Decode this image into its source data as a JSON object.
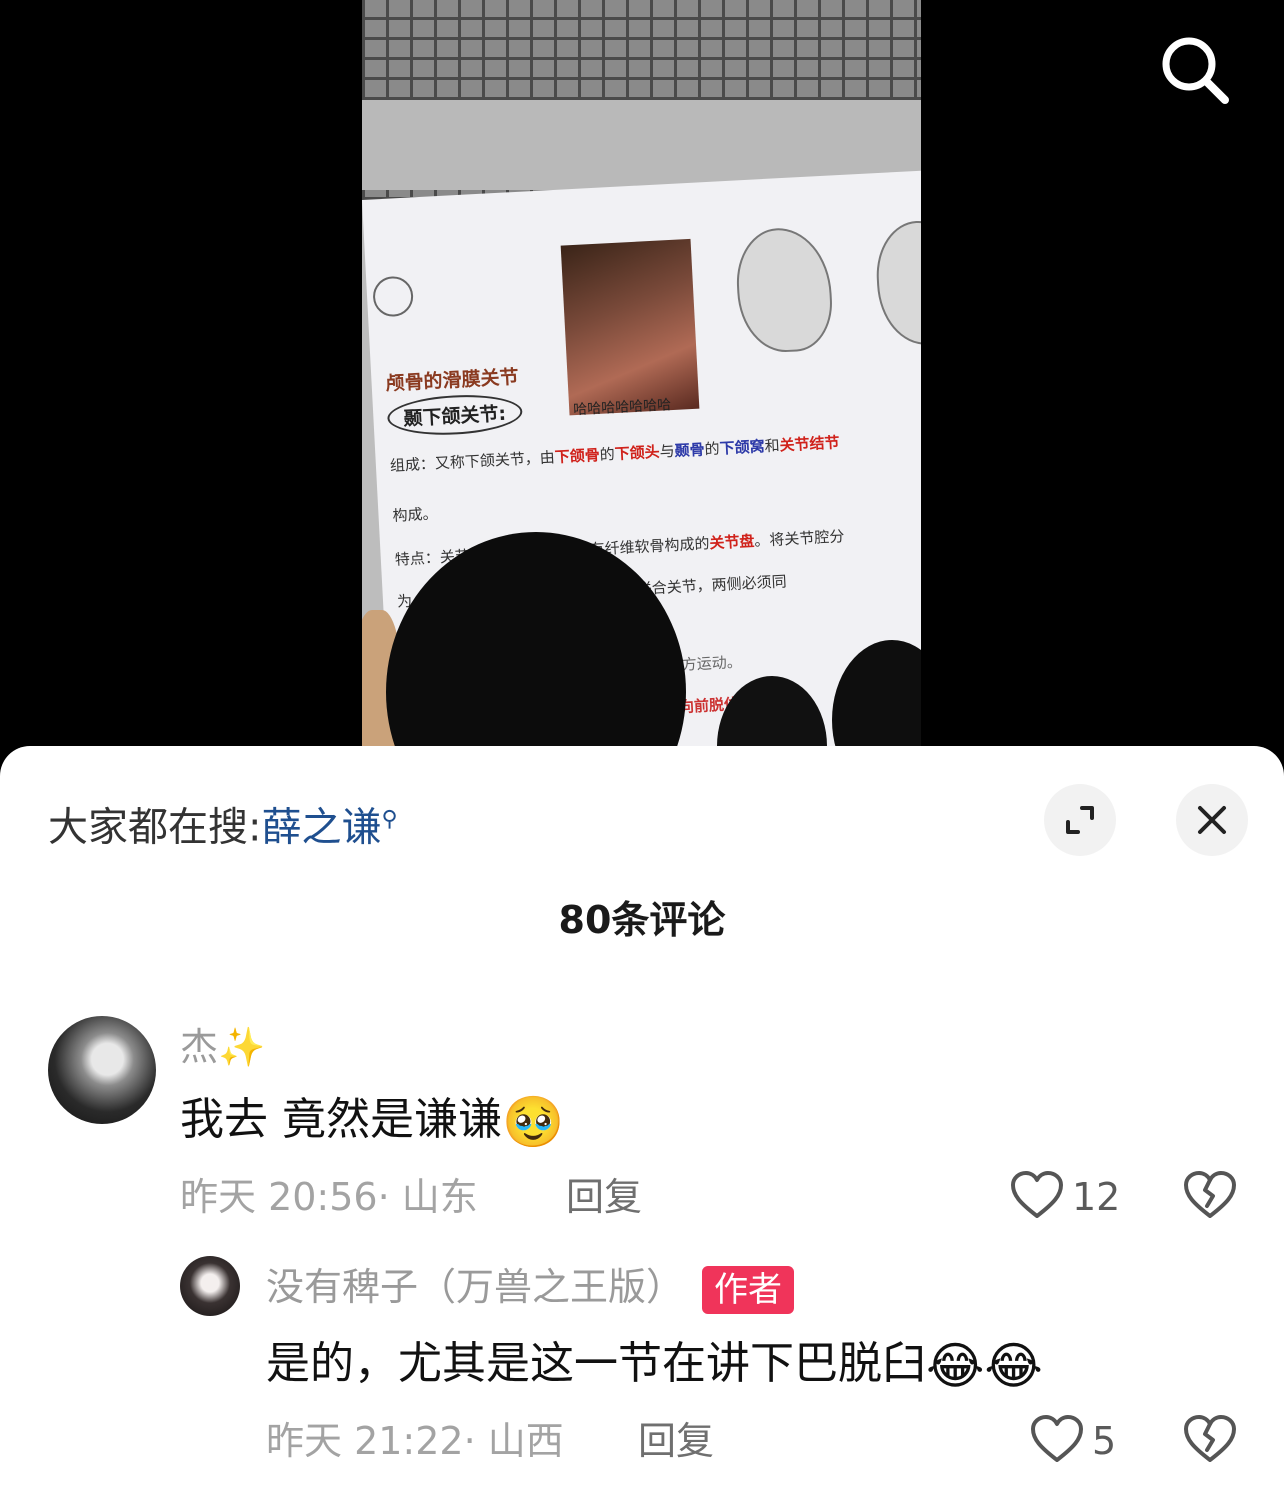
{
  "video": {
    "slide": {
      "photo_caption": "哈哈哈哈哈哈哈",
      "title": "颅骨的滑膜关节",
      "circled_heading": "颞下颌关节:",
      "line1_prefix": "组成：又称下颌关节，由",
      "line1_red1": "下颌骨",
      "line1_mid1": "的",
      "line1_red2": "下颌头",
      "line1_mid2": "与",
      "line1_blue1": "颞骨",
      "line1_mid3": "的",
      "line1_blue2": "下颌窝",
      "line1_mid4": "和",
      "line1_red3": "关节结节",
      "line2": "构成。",
      "line3_prefix": "特点：关节囊松弛，关节囊内有纤维软骨构成的",
      "line3_red": "关节盘",
      "line3_suffix": "。将关节腔分",
      "line4": "为上、下两腔，外侧韧带加强。属于联合关节，两侧必须同",
      "line5": "侧方运动。",
      "line6": "向前脱位"
    }
  },
  "sheet": {
    "search_label": "大家都在搜:",
    "search_query": "薛之谦",
    "comment_count_title": "80条评论",
    "comments": [
      {
        "username": "杰✨",
        "text": "我去 竟然是谦谦",
        "emoji": "🥹",
        "meta": "昨天 20:56· 山东",
        "reply_label": "回复",
        "likes": "12"
      },
      {
        "username": "没有稗子（万兽之王版）",
        "author_tag": "作者",
        "text": "是的，尤其是这一节在讲下巴脱臼",
        "emoji": "😂😂",
        "meta": "昨天 21:22· 山西",
        "reply_label": "回复",
        "likes": "5"
      }
    ]
  },
  "colors": {
    "author_tag_bg": "#f0345a",
    "query_link": "#1f4f8f",
    "meta_gray": "#a3a3a3"
  },
  "icons": {
    "top_search": "search-icon",
    "expand": "expand-icon",
    "close": "close-icon",
    "like": "heart-icon",
    "dislike": "broken-heart-icon"
  }
}
